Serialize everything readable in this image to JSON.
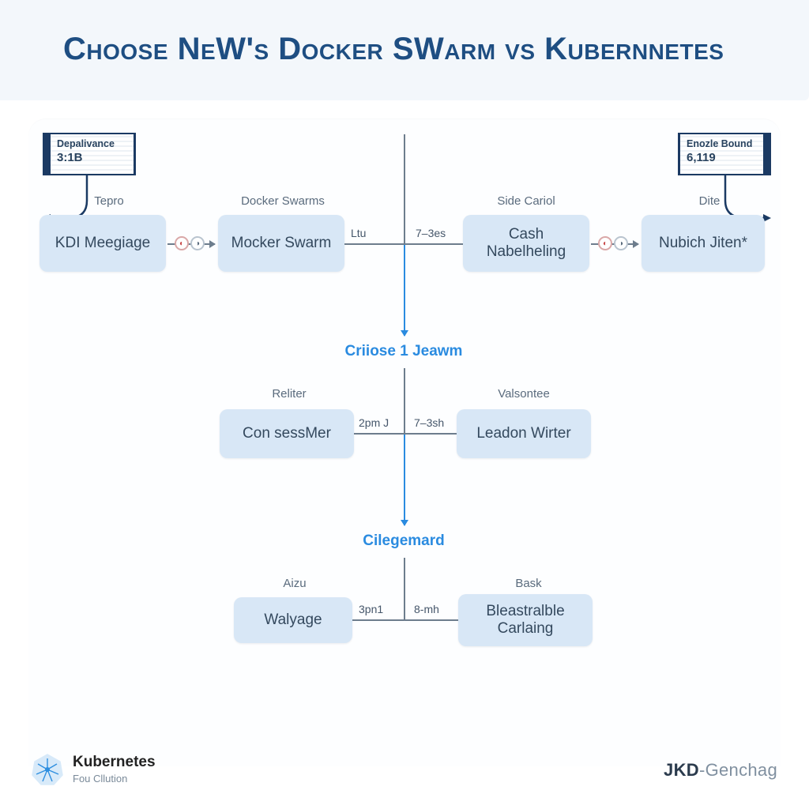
{
  "title": "Choose NeW's Docker SWarm vs Kubernnetes",
  "tags": {
    "left": {
      "label": "Depalivance",
      "value": "3:1B"
    },
    "right": {
      "label": "Enozle Bound",
      "value": "6,119"
    }
  },
  "row1": {
    "left_caption": "Tepro",
    "left_node": "KDI Meegiage",
    "mid_left_caption": "Docker Swarms",
    "mid_left_node": "Mocker Swarm",
    "mid_right_caption": "Side Cariol",
    "mid_right_node": "Cash Nabelheling",
    "right_caption": "Dite",
    "right_node": "Nubich Jiten*",
    "edge_left": "Ltu",
    "edge_right": "7–3es"
  },
  "section1": "Criiose 1 Jeawm",
  "row2": {
    "left_caption": "Reliter",
    "left_node": "Con sessMer",
    "right_caption": "Valsontee",
    "right_node": "Leadon Wirter",
    "edge_left": "2pm J",
    "edge_right": "7–3sh"
  },
  "section2": "Cilegemard",
  "row3": {
    "left_caption": "Aizu",
    "left_node": "Walyage",
    "right_caption": "Bask",
    "right_node": "Bleastralble Carlaing",
    "edge_left": "3pn1",
    "edge_right": "8-mh"
  },
  "footer": {
    "brand_name": "Kubernetes",
    "brand_sub": "Fou Cllution",
    "right_brand_bold": "JKD",
    "right_brand_sep": "-",
    "right_brand_light": "Genchag"
  }
}
